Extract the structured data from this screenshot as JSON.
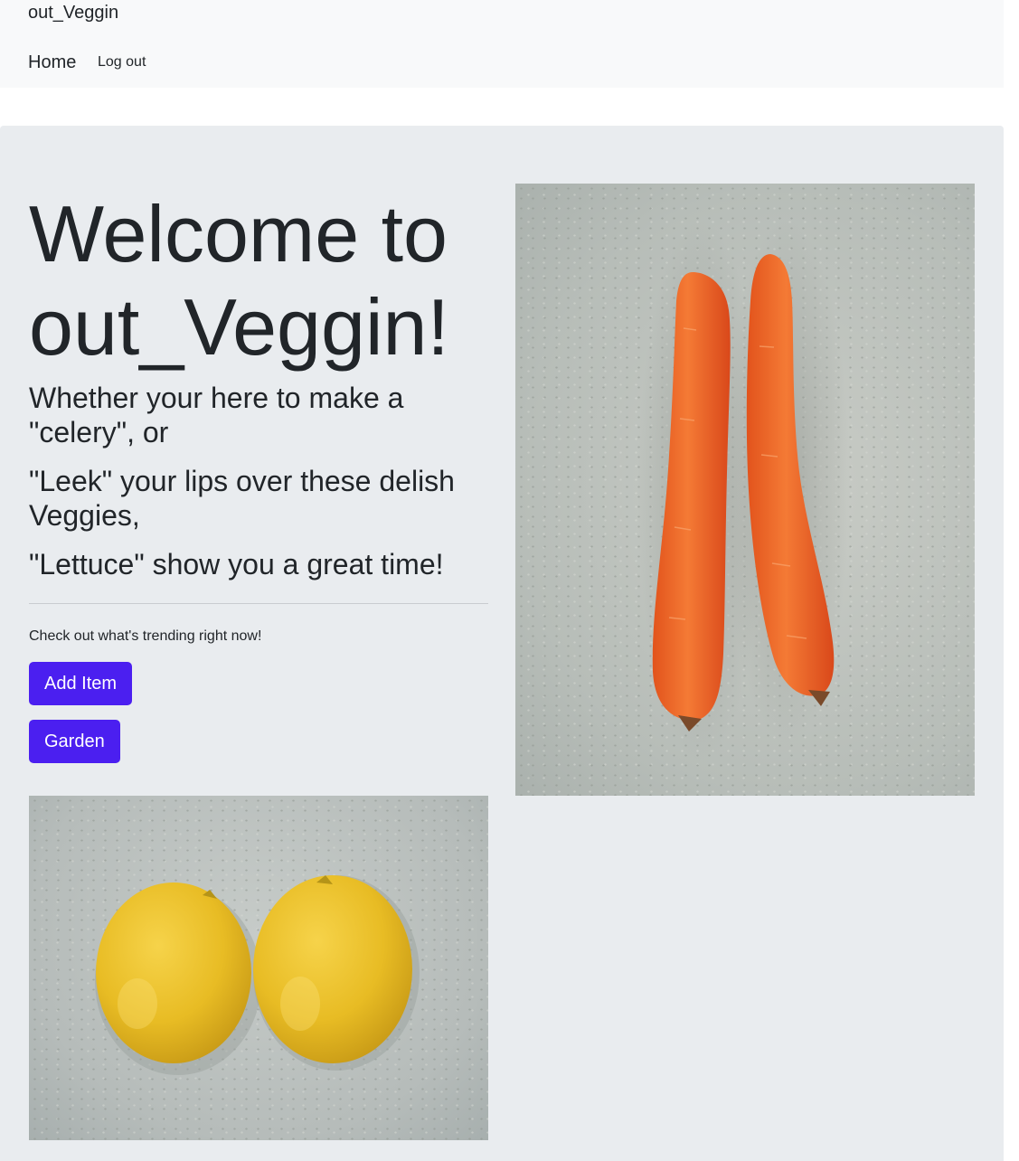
{
  "navbar": {
    "brand": "out_Veggin",
    "home_label": "Home",
    "logout_label": "Log out"
  },
  "hero": {
    "title": "Welcome to out_Veggin!",
    "lines": [
      "Whether your here to make a \"celery\", or",
      "\"Leek\" your lips over these delish Veggies,",
      "\"Lettuce\" show you a great time!"
    ],
    "trending_text": "Check out what's trending right now!",
    "add_item_label": "Add Item",
    "garden_label": "Garden",
    "button_color": "#4b1ff0"
  },
  "images": {
    "carrots": "carrots-photo",
    "lemons": "lemons-photo"
  }
}
